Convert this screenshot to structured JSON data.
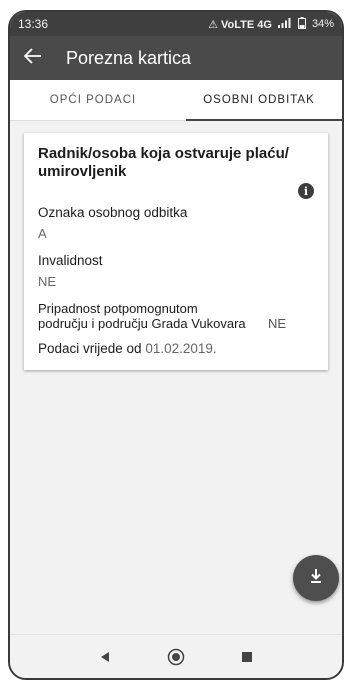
{
  "status_bar": {
    "time": "13:36",
    "icons_text": "⚠ VoLTE 4G",
    "battery": "34%"
  },
  "app_bar": {
    "back_icon": "arrow-left-icon",
    "title": "Porezna kartica"
  },
  "tabs": [
    {
      "label": "OPĆI PODACI",
      "active": false
    },
    {
      "label": "OSOBNI ODBITAK",
      "active": true
    }
  ],
  "card": {
    "title": "Radnik/osoba koja ostvaruje plaću/ umirovljenik",
    "info_icon": "info-icon",
    "fields": [
      {
        "label": "Oznaka osobnog odbitka",
        "value": "A"
      },
      {
        "label": "Invalidnost",
        "value": "NE"
      }
    ],
    "region_label": "Pripadnost potpomognutom području i području Grada Vukovara",
    "region_value": "NE",
    "valid_from_label": "Podaci vrijede od",
    "valid_from_date": "01.02.2019."
  },
  "fab": {
    "icon": "download-icon"
  },
  "nav_bar": [
    "back-triangle-icon",
    "home-circle-icon",
    "recents-square-icon"
  ],
  "colors": {
    "app_bar": "#4a4a4a",
    "status_bar": "#3f3f3f",
    "fab": "#4e4e4e",
    "background": "#f2f2f2"
  }
}
